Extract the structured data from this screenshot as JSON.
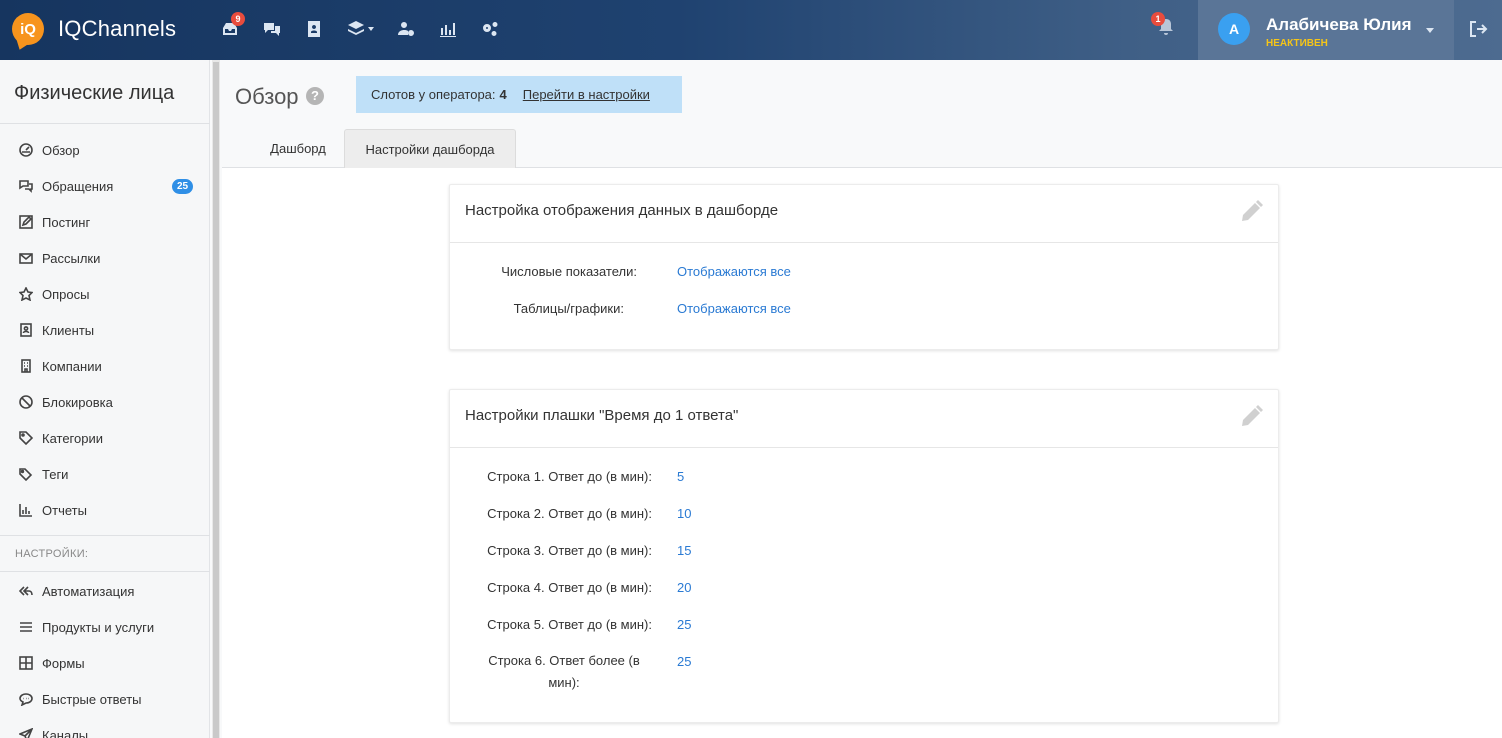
{
  "app": {
    "name": "IQChannels",
    "logo_mark": "iQ"
  },
  "topnav": {
    "icons": [
      "inbox-icon",
      "chat-icon",
      "contacts-icon",
      "layers-icon",
      "user-settings-icon",
      "analytics-icon",
      "settings-gears-icon"
    ],
    "inbox_badge": "9",
    "bell_badge": "1"
  },
  "user": {
    "initial": "А",
    "name": "Алабичева Юлия",
    "status": "НЕАКТИВЕН"
  },
  "sidebar": {
    "title": "Физические лица",
    "items": [
      {
        "label": "Обзор",
        "icon": "dashboard-icon"
      },
      {
        "label": "Обращения",
        "icon": "chats-icon",
        "badge": "25"
      },
      {
        "label": "Постинг",
        "icon": "edit-square-icon"
      },
      {
        "label": "Рассылки",
        "icon": "envelope-icon"
      },
      {
        "label": "Опросы",
        "icon": "star-icon"
      },
      {
        "label": "Клиенты",
        "icon": "address-book-icon"
      },
      {
        "label": "Компании",
        "icon": "building-icon"
      },
      {
        "label": "Блокировка",
        "icon": "ban-icon"
      },
      {
        "label": "Категории",
        "icon": "tag-icon"
      },
      {
        "label": "Теги",
        "icon": "tags-icon"
      },
      {
        "label": "Отчеты",
        "icon": "bar-chart-icon"
      }
    ],
    "section_label": "НАСТРОЙКИ:",
    "settings_items": [
      {
        "label": "Автоматизация",
        "icon": "reply-all-icon"
      },
      {
        "label": "Продукты и услуги",
        "icon": "list-icon"
      },
      {
        "label": "Формы",
        "icon": "grid-icon"
      },
      {
        "label": "Быстрые ответы",
        "icon": "comment-dots-icon"
      },
      {
        "label": "Каналы",
        "icon": "send-icon"
      }
    ]
  },
  "header": {
    "title": "Обзор",
    "help": "?",
    "slots_label": "Слотов у оператора:",
    "slots_value": "4",
    "slots_link": "Перейти в настройки",
    "tabs": [
      {
        "label": "Дашборд"
      },
      {
        "label": "Настройки дашборда"
      }
    ]
  },
  "card1": {
    "title": "Настройка отображения данных в дашборде",
    "rows": [
      {
        "label": "Числовые показатели:",
        "value": "Отображаются все"
      },
      {
        "label": "Таблицы/графики:",
        "value": "Отображаются все"
      }
    ]
  },
  "card2": {
    "title": "Настройки плашки \"Время до 1 ответа\"",
    "rows": [
      {
        "label": "Строка 1. Ответ до (в мин):",
        "value": "5"
      },
      {
        "label": "Строка 2. Ответ до (в мин):",
        "value": "10"
      },
      {
        "label": "Строка 3. Ответ до (в мин):",
        "value": "15"
      },
      {
        "label": "Строка 4. Ответ до (в мин):",
        "value": "20"
      },
      {
        "label": "Строка 5. Ответ до (в мин):",
        "value": "25"
      },
      {
        "label": "Строка 6. Ответ более (в мин):",
        "value": "25"
      }
    ]
  }
}
